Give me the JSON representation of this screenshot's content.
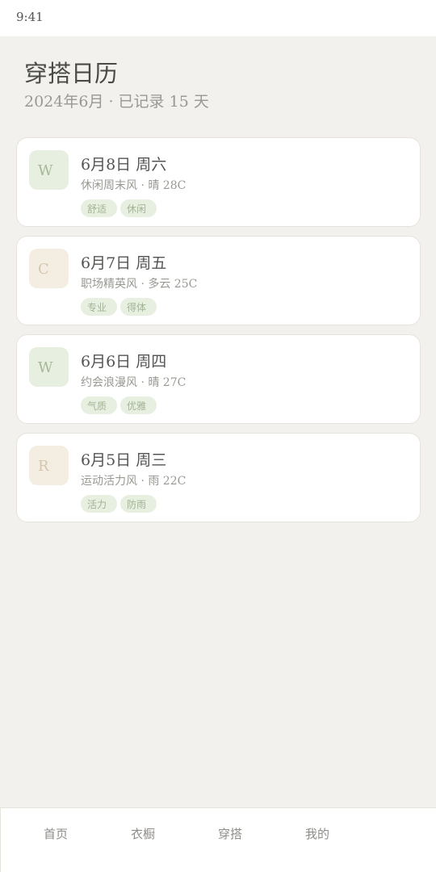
{
  "status_bar": {
    "time": "9:41"
  },
  "header": {
    "title": "穿搭日历",
    "subtitle": "2024年6月 · 已记录 15 天"
  },
  "entries": [
    {
      "avatar_letter": "W",
      "avatar_color": "#e7efe0",
      "date": "6月8日 周六",
      "desc": "休闲周末风 · 晴 28C",
      "tags": [
        "舒适",
        "休闲"
      ]
    },
    {
      "avatar_letter": "C",
      "avatar_color": "#f4ede2",
      "date": "6月7日 周五",
      "desc": "职场精英风 · 多云 25C",
      "tags": [
        "专业",
        "得体"
      ]
    },
    {
      "avatar_letter": "W",
      "avatar_color": "#e7efe0",
      "date": "6月6日 周四",
      "desc": "约会浪漫风 · 晴 27C",
      "tags": [
        "气质",
        "优雅"
      ]
    },
    {
      "avatar_letter": "R",
      "avatar_color": "#f4ede2",
      "date": "6月5日 周三",
      "desc": "运动活力风 · 雨 22C",
      "tags": [
        "活力",
        "防雨"
      ]
    }
  ],
  "tab_bar": {
    "tabs": [
      {
        "label": "首页"
      },
      {
        "label": "衣橱"
      },
      {
        "label": "穿搭"
      },
      {
        "label": "我的"
      }
    ]
  }
}
